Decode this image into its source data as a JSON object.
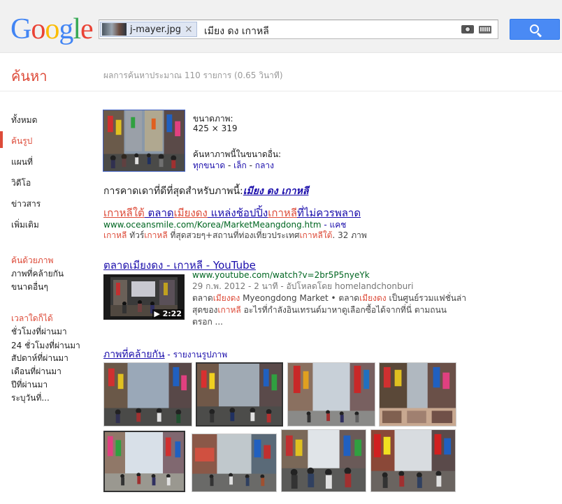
{
  "logo": [
    "G",
    "o",
    "o",
    "g",
    "l",
    "e"
  ],
  "search": {
    "chip_label": "j-mayer.jpg",
    "chip_close": "×",
    "query": "เมียง ดง เกาหลี"
  },
  "header": {
    "title": "ค้นหา",
    "stats": "ผลการค้นหาประมาณ 110 รายการ (0.65 วินาที)"
  },
  "sidebar": {
    "items": [
      "ทั้งหมด",
      "ค้นรูป",
      "แผนที่",
      "วิดีโอ",
      "ข่าวสาร",
      "เพิ่มเติม"
    ],
    "section1_title": "ค้นด้วยภาพ",
    "section1_links": [
      "ภาพที่คล้ายกัน",
      "ขนาดอื่นๆ"
    ],
    "section2_title": "เวลาใดก็ได้",
    "section2_links": [
      "ชั่วโมงที่ผ่านมา",
      "24 ชั่วโมงที่ผ่านมา",
      "สัปดาห์ที่ผ่านมา",
      "เดือนที่ผ่านมา",
      "ปีที่ผ่านมา",
      "ระบุวันที่..."
    ]
  },
  "image_info": {
    "size_label": "ขนาดภาพ:",
    "size_value": "425 × 319",
    "other_sizes_label": "ค้นหาภาพนี้ในขนาดอื่น:",
    "size_all": "ทุกขนาด",
    "size_small": "เล็ก",
    "size_medium": "กลาง",
    "sep": " - "
  },
  "best_guess": {
    "label": "การคาดเดาที่ดีที่สุดสำหรับภาพนี้:",
    "query": "เมียง ดง เกาหลี"
  },
  "result1": {
    "t1": "เกาหลีใต้",
    "t2": " ตลาด",
    "t3": "เมียงดง",
    "t4": " แหล่งช้อปปิ้ง",
    "t5": "เกาหลี",
    "t6": "ที่ไม่ควรพลาด",
    "url": "www.oceansmile.com/Korea/MarketMeangdong.htm",
    "cache": " - แคช",
    "s1": "เกาหลี",
    "s2": " ทัวร์",
    "s3": "เกาหลี",
    "s4": " ที่สุดสวยๆ+สถานที่ท่องเที่ยวประเทศ",
    "s5": "เกาหลีใต้",
    "s6": ". 32 ภาพ"
  },
  "result2": {
    "t1": "ตลาดเมียงดง",
    "t2": " - ",
    "t3": "เกาหลี",
    "t4": " - YouTube",
    "url": "www.youtube.com/watch?v=2br5P5nyeYk",
    "meta": "29 ก.พ. 2012 - 2 นาที - อัปโหลดโดย homelandchonburi",
    "l1a": "ตลาด",
    "l1b": "เมียงดง",
    "l1c": " Myeongdong Market • ตลาด",
    "l1d": "เมียงดง",
    "l1e": " เป็นศูนย์รวมแฟชั่นล่า",
    "l2a": "สุดของ",
    "l2b": "เกาหลี",
    "l2c": " อะไรที่กำลังอินเทรนด์มาหาดูเลือกซื้อได้จากที่นี่ ตามถนน",
    "l3": "ตรอก ...",
    "duration": "▶ 2:22"
  },
  "similar": {
    "title": "ภาพที่คล้ายกัน",
    "sub": " - รายงานรูปภาพ"
  },
  "colors": {
    "accent_red": "#dd4b39",
    "link_blue": "#1a0dab",
    "url_green": "#006621",
    "button_blue": "#4a8af4"
  }
}
